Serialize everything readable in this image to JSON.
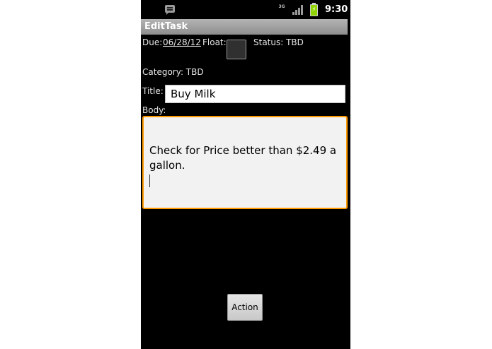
{
  "status_bar": {
    "time": "9:30",
    "network_label": "3G",
    "icons": [
      "message-icon",
      "network-3g-icon",
      "signal-icon",
      "battery-charging-icon"
    ]
  },
  "app": {
    "title": "EditTask"
  },
  "form": {
    "due_label": "Due:",
    "due_value": "06/28/12",
    "float_label": "Float:",
    "float_checked": false,
    "status_label": "Status: TBD",
    "category_label": "Category: TBD",
    "title_label": "Title:",
    "title_value": "Buy Milk",
    "body_label": "Body:",
    "body_value": "Check for Price better than $2.49 a gallon."
  },
  "actions": {
    "action_label": "Action"
  },
  "colors": {
    "accent_focus": "#ff9900",
    "battery": "#8fd400"
  }
}
